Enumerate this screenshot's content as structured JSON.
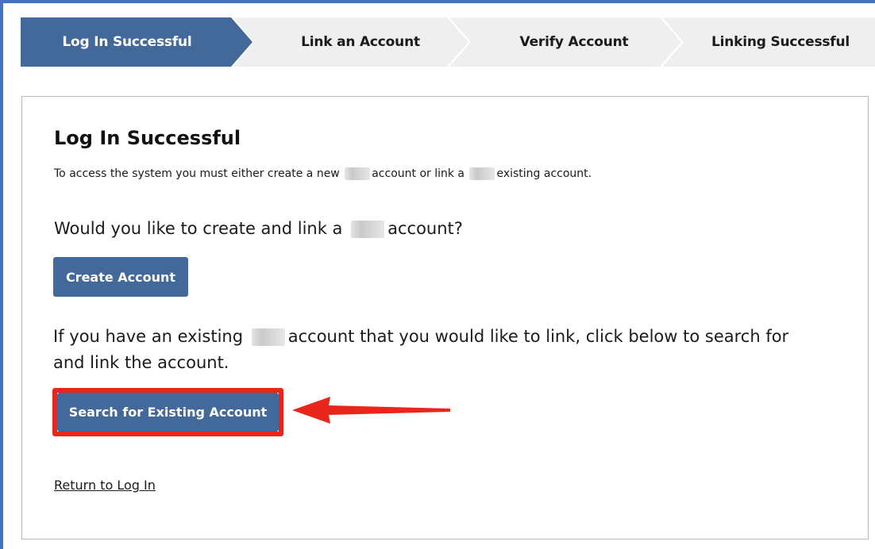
{
  "stepper": {
    "steps": [
      {
        "label": "Log In Successful",
        "state": "active"
      },
      {
        "label": "Link an Account",
        "state": "upcoming"
      },
      {
        "label": "Verify Account",
        "state": "upcoming"
      },
      {
        "label": "Linking Successful",
        "state": "upcoming"
      }
    ]
  },
  "main": {
    "title": "Log In Successful",
    "intro": {
      "part1": "To access the system you must either create a new",
      "part2": "account or link a",
      "part3": "existing account."
    },
    "question": {
      "part1": "Would you like to create and link a",
      "part2": "account?"
    },
    "create_button_label": "Create Account",
    "existing": {
      "part1": "If you have an existing",
      "part2": "account that you would like to link, click below to search for and link the account."
    },
    "search_button_label": "Search for Existing Account",
    "return_link_label": "Return to Log In"
  },
  "colors": {
    "primary": "#43689a",
    "step_inactive": "#efefef",
    "highlight_annotation": "#e8261c",
    "frame": "#4472c4"
  }
}
